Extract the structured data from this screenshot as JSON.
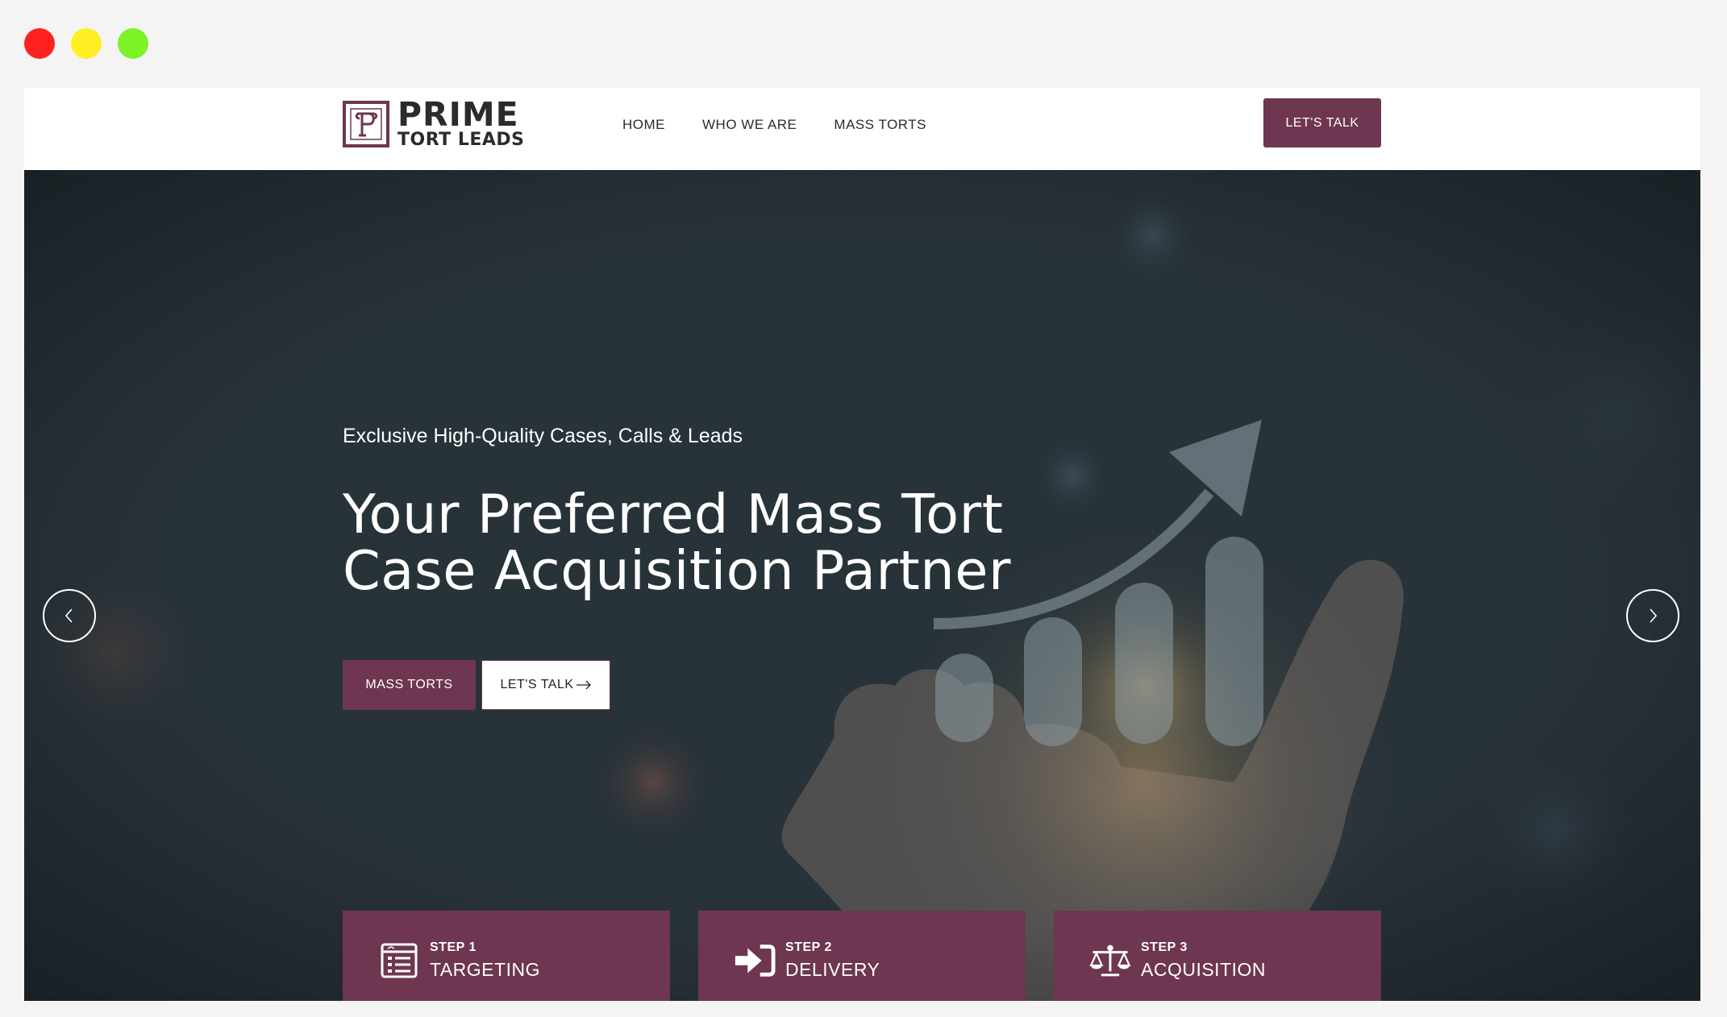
{
  "window": {
    "controls": [
      "close",
      "minimize",
      "maximize"
    ]
  },
  "header": {
    "logo": {
      "mark": "P",
      "title": "PRIME",
      "subtitle": "TORT LEADS"
    },
    "nav": [
      {
        "label": "HOME"
      },
      {
        "label": "WHO WE ARE"
      },
      {
        "label": "MASS TORTS"
      }
    ],
    "cta_label": "LET'S TALK"
  },
  "hero": {
    "subtitle": "Exclusive High-Quality Cases, Calls & Leads",
    "title_line1": "Your Preferred Mass Tort",
    "title_line2": "Case Acquisition Partner",
    "primary_button": "MASS TORTS",
    "secondary_button": "LET'S TALK",
    "secondary_button_icon": "arrow-right-icon",
    "prev_icon": "chevron-left-icon",
    "next_icon": "chevron-right-icon"
  },
  "steps": [
    {
      "number": "STEP 1",
      "label": "TARGETING",
      "icon": "list-window-icon"
    },
    {
      "number": "STEP 2",
      "label": "DELIVERY",
      "icon": "sign-in-icon"
    },
    {
      "number": "STEP 3",
      "label": "ACQUISITION",
      "icon": "scales-icon"
    }
  ],
  "colors": {
    "brand": "#6e3650",
    "hero_bg": "#283239",
    "header_bg": "#ffffff",
    "text_dark": "#2a2a2a"
  }
}
